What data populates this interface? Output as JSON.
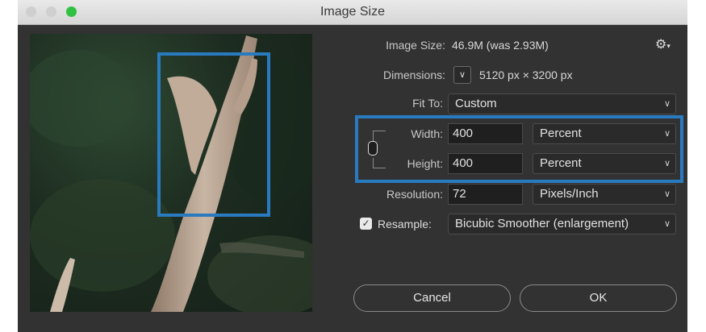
{
  "window": {
    "title": "Image Size"
  },
  "traffic_lights": {
    "close": "#cfcfcf",
    "minimize": "#cfcfcf",
    "zoom": "#2fc13f"
  },
  "info": {
    "image_size_label": "Image Size:",
    "image_size_value": "46.9M (was 2.93M)",
    "dimensions_label": "Dimensions:",
    "dimensions_value": "5120 px  ×  3200 px"
  },
  "fit_to": {
    "label": "Fit To:",
    "value": "Custom"
  },
  "width": {
    "label": "Width:",
    "value": "400",
    "unit": "Percent"
  },
  "height": {
    "label": "Height:",
    "value": "400",
    "unit": "Percent"
  },
  "resolution": {
    "label": "Resolution:",
    "value": "72",
    "unit": "Pixels/Inch"
  },
  "resample": {
    "label": "Resample:",
    "checked": true,
    "method": "Bicubic Smoother (enlargement)"
  },
  "buttons": {
    "cancel": "Cancel",
    "ok": "OK"
  },
  "icons": {
    "settings": "gear-icon",
    "link": "chain-link-icon"
  },
  "colors": {
    "highlight": "#2a7ac0",
    "dialog_bg": "#323232"
  }
}
